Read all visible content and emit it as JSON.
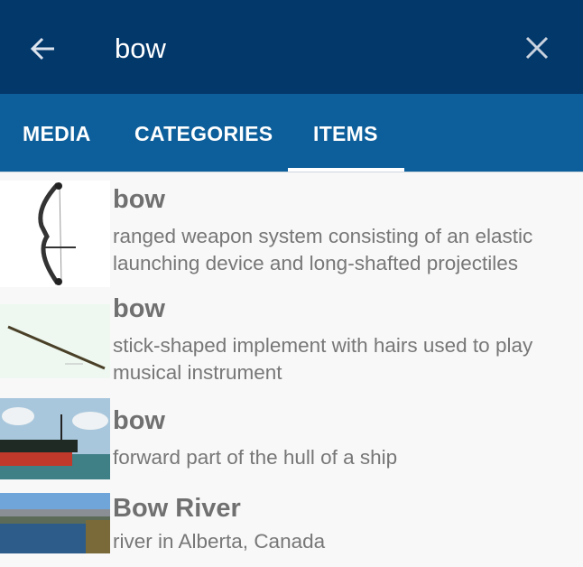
{
  "search": {
    "query": "bow",
    "back_icon": "arrow-left-icon",
    "clear_icon": "close-icon"
  },
  "tabs": [
    {
      "label": "MEDIA",
      "selected": false
    },
    {
      "label": "CATEGORIES",
      "selected": false
    },
    {
      "label": "ITEMS",
      "selected": true
    }
  ],
  "colors": {
    "toolbar": "#03386b",
    "tabbar": "#0d5f9b",
    "background": "#f8f8f8"
  },
  "results": [
    {
      "title": "bow",
      "description_line1": "ranged weapon system consisting of an elastic",
      "description_line2": "launching device and long-shafted projectiles"
    },
    {
      "title": "bow",
      "description_line1": "stick-shaped implement with hairs used to play",
      "description_line2": "musical instrument"
    },
    {
      "title": "bow",
      "description_line1": "forward part of the hull of a ship",
      "description_line2": ""
    },
    {
      "title": "Bow River",
      "description_line1": "river in Alberta, Canada",
      "description_line2": ""
    }
  ]
}
